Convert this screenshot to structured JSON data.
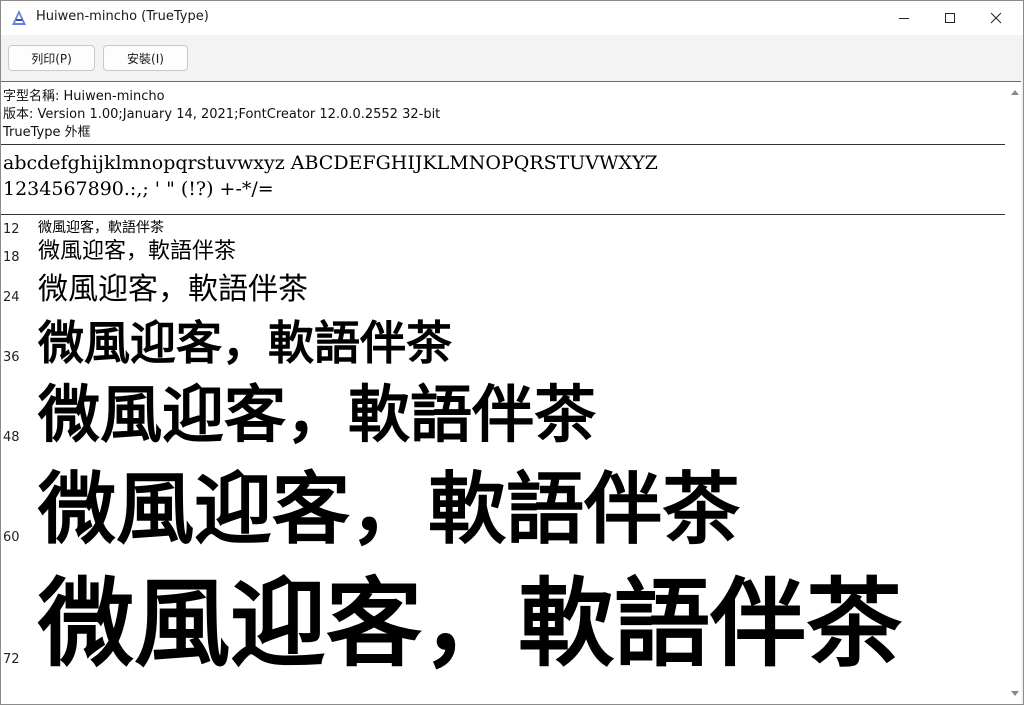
{
  "window": {
    "title": "Huiwen-mincho (TrueType)"
  },
  "toolbar": {
    "print_label": "列印(P)",
    "install_label": "安裝(I)"
  },
  "info": {
    "font_name": "字型名稱: Huiwen-mincho",
    "version": "版本: Version 1.00;January 14, 2021;FontCreator 12.0.0.2552 32-bit",
    "outline": "TrueType 外框"
  },
  "sample": {
    "alphabet": "abcdefghijklmnopqrstuvwxyz ABCDEFGHIJKLMNOPQRSTUVWXYZ",
    "digits": "1234567890.:,; ' \" (!?) +-*/="
  },
  "sizes": [
    {
      "size": "12",
      "text": "微風迎客，軟語伴茶"
    },
    {
      "size": "18",
      "text": "微風迎客，軟語伴茶"
    },
    {
      "size": "24",
      "text": "微風迎客，軟語伴茶"
    },
    {
      "size": "36",
      "text": "微風迎客，軟語伴茶"
    },
    {
      "size": "48",
      "text": "微風迎客，軟語伴茶"
    },
    {
      "size": "60",
      "text": "微風迎客，軟語伴茶"
    },
    {
      "size": "72",
      "text": "微風迎客，軟語伴茶"
    }
  ],
  "icons": {
    "app": "font-viewer-icon",
    "minimize": "minimize-icon",
    "maximize": "maximize-icon",
    "close": "close-icon"
  }
}
